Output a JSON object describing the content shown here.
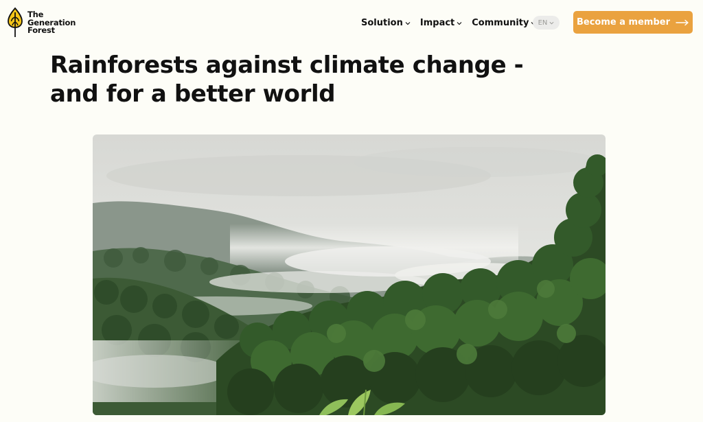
{
  "header": {
    "logo": {
      "line1": "The",
      "line2": "Generation",
      "line3": "Forest"
    },
    "nav": [
      {
        "label": "Solution"
      },
      {
        "label": "Impact"
      },
      {
        "label": "Community"
      }
    ],
    "language": "EN",
    "cta_label": "Become a member"
  },
  "hero": {
    "title_line1": "Rainforests against climate change -",
    "title_line2": "and for a better world"
  },
  "icons": {
    "logo": "leaf-seed-logo-icon",
    "nav_dropdown": "chevron-down-icon",
    "cta": "arrow-right-icon"
  },
  "colors": {
    "background": "#fdfdf7",
    "accent": "#eaa23f",
    "logo_yellow": "#f5c518",
    "language_pill": "#ececea"
  }
}
